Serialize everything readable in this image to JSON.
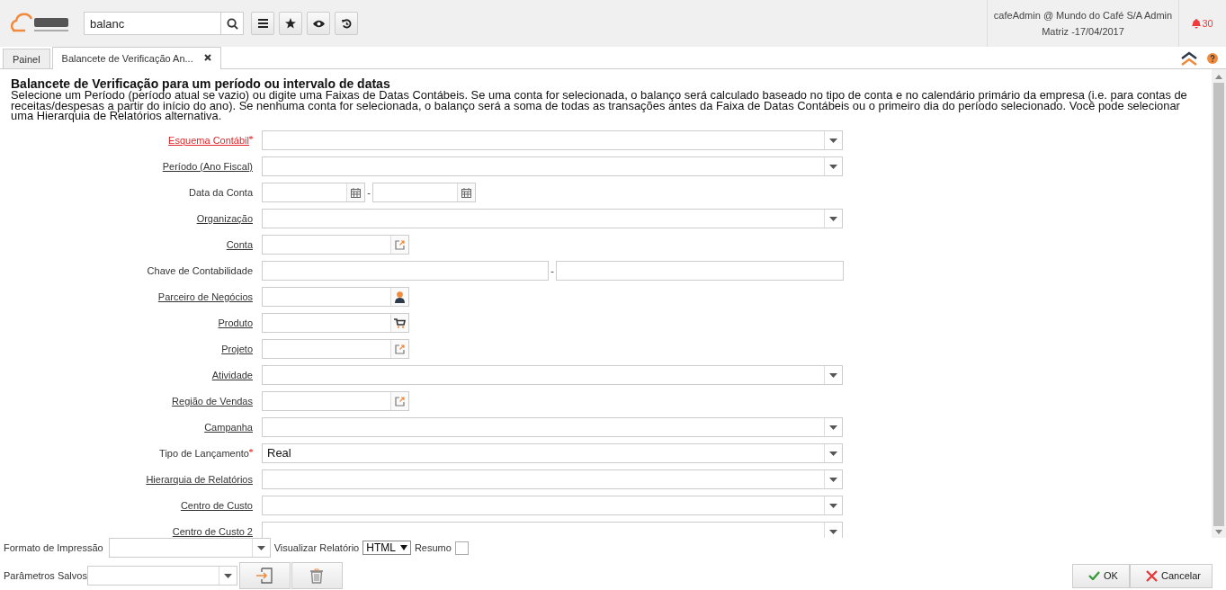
{
  "header": {
    "search": {
      "value": "balanc"
    },
    "user": {
      "line1": "cafeAdmin @ Mundo do Café S/A Admin",
      "line2": "Matriz -17/04/2017"
    },
    "notifications": "30"
  },
  "tabs": [
    {
      "label": "Painel",
      "selected": false,
      "closable": false
    },
    {
      "label": "Balancete de Verificação An...",
      "selected": true,
      "closable": true
    }
  ],
  "process": {
    "title": "Balancete de Verificação para um período ou intervalo de datas",
    "description": "Selecione um Período (período atual se vazio) ou digite uma Faixas de Datas Contábeis. Se uma conta for selecionada, o balanço será calculado baseado no tipo de conta e no calendário primário da empresa (i.e. para contas de receitas/despesas a partir do início do ano). Se nenhuma conta for selecionada, o balanço será a soma de todas as transações antes da Faixa de Datas Contábeis ou o primeiro dia do período selecionado. Você pode selecionar uma Hierarquia de Relatórios alternativa."
  },
  "fields": [
    {
      "label": "Esquema Contábil",
      "kind": "select",
      "link": true,
      "required": true,
      "missing": true
    },
    {
      "label": "Período (Ano Fiscal)",
      "kind": "select",
      "link": true,
      "required": false,
      "missing": false
    },
    {
      "label": "Data da Conta",
      "kind": "date_range",
      "link": false,
      "required": false,
      "missing": false,
      "separator": "-"
    },
    {
      "label": "Organização",
      "kind": "select",
      "link": true,
      "required": false,
      "missing": false
    },
    {
      "label": "Conta",
      "kind": "lookup",
      "link": true,
      "required": false,
      "missing": false
    },
    {
      "label": "Chave de Contabilidade",
      "kind": "text_range",
      "link": false,
      "required": false,
      "missing": false,
      "separator": "-"
    },
    {
      "label": "Parceiro de Negócios",
      "kind": "partner",
      "link": true,
      "required": false,
      "missing": false
    },
    {
      "label": "Produto",
      "kind": "product",
      "link": true,
      "required": false,
      "missing": false
    },
    {
      "label": "Projeto",
      "kind": "lookup",
      "link": true,
      "required": false,
      "missing": false
    },
    {
      "label": "Atividade",
      "kind": "select",
      "link": true,
      "required": false,
      "missing": false
    },
    {
      "label": "Região de Vendas",
      "kind": "lookup",
      "link": true,
      "required": false,
      "missing": false
    },
    {
      "label": "Campanha",
      "kind": "select",
      "link": true,
      "required": false,
      "missing": false
    },
    {
      "label": "Tipo de Lançamento",
      "kind": "select",
      "link": false,
      "required": true,
      "missing": false,
      "value": "Real"
    },
    {
      "label": "Hierarquia de Relatórios",
      "kind": "select",
      "link": true,
      "required": false,
      "missing": false
    },
    {
      "label": "Centro de Custo",
      "kind": "select",
      "link": true,
      "required": false,
      "missing": false
    },
    {
      "label": "Centro de Custo 2",
      "kind": "select",
      "link": true,
      "required": false,
      "missing": false
    }
  ],
  "footer": {
    "print_format_label": "Formato de Impressão",
    "view_report_label": "Visualizar Relatório",
    "view_report_value": "HTML",
    "summary_label": "Resumo",
    "summary_checked": false,
    "saved_params_label": "Parâmetros Salvos",
    "ok": "OK",
    "cancel": "Cancelar"
  }
}
